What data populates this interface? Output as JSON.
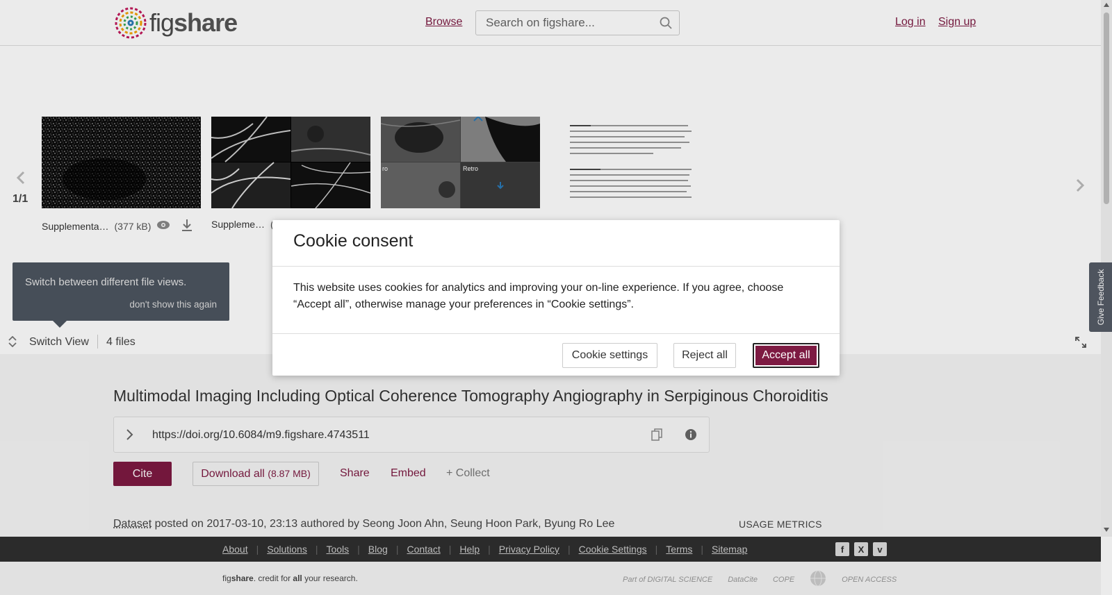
{
  "header": {
    "logo_text_light": "fig",
    "logo_text_bold": "share",
    "browse_label": "Browse",
    "search_placeholder": "Search on figshare...",
    "login_label": "Log in",
    "signup_label": "Sign up"
  },
  "carousel": {
    "counter": "1/1",
    "files": [
      {
        "name": "Supplementa…",
        "size": "(377 kB)"
      },
      {
        "name": "Suppleme…",
        "size": "("
      },
      {
        "name": "",
        "size": ""
      },
      {
        "name": "",
        "size": ""
      }
    ],
    "thumb3_labels": [
      "Retro"
    ]
  },
  "tooltip": {
    "text": "Switch between different file views.",
    "dismiss": "don't show this again"
  },
  "switch_bar": {
    "switch_label": "Switch View",
    "files_label": "4 files"
  },
  "article": {
    "title": "Multimodal Imaging Including Optical Coherence Tomography Angiography in Serpiginous Choroiditis",
    "doi": "https://doi.org/10.6084/m9.figshare.4743511",
    "cite_label": "Cite",
    "download_label": "Download all",
    "download_size": "(8.87 MB)",
    "share_label": "Share",
    "embed_label": "Embed",
    "collect_label": "+ Collect",
    "dataset_type": "Dataset",
    "posted_text": " posted on 2017-03-10, 23:13 authored by Seong Joon Ahn, Seung Hoon Park, Byung Ro Lee",
    "usage_metrics": "USAGE METRICS"
  },
  "feedback_label": "Give Feedback",
  "cookie_modal": {
    "title": "Cookie consent",
    "body": "This website uses cookies for analytics and improving your on-line experience. If you agree, choose “Accept all”, otherwise manage your preferences in “Cookie settings”.",
    "settings_label": "Cookie settings",
    "reject_label": "Reject all",
    "accept_label": "Accept all"
  },
  "footer": {
    "links": [
      "About",
      "Solutions",
      "Tools",
      "Blog",
      "Contact",
      "Help",
      "Privacy Policy",
      "Cookie Settings",
      "Terms",
      "Sitemap"
    ],
    "social": [
      "f",
      "X",
      "v"
    ],
    "tagline_fig": "fig",
    "tagline_share": "share",
    "tagline_mid": ". credit for ",
    "tagline_all": "all",
    "tagline_end": " your research.",
    "partners": [
      "Part of DIGITAL SCIENCE",
      "DataCite",
      "COPE",
      "",
      "OPEN ACCESS"
    ]
  },
  "colors": {
    "brand": "#7d1a42",
    "footer_dark": "#2f2f2f",
    "tooltip_bg": "#4d5560"
  }
}
